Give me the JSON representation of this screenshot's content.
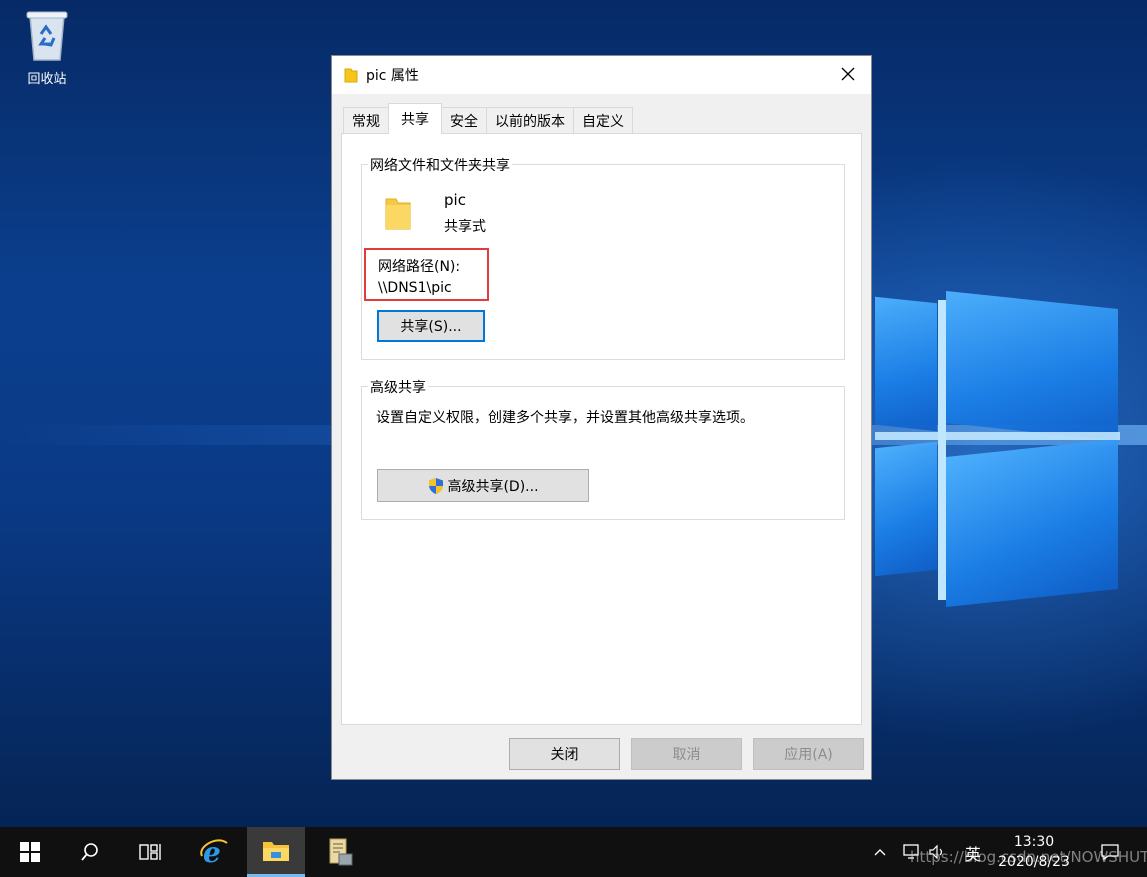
{
  "desktop": {
    "recycle_bin_label": "回收站"
  },
  "dialog": {
    "title": "pic 属性",
    "tabs": [
      {
        "label": "常规"
      },
      {
        "label": "共享"
      },
      {
        "label": "安全"
      },
      {
        "label": "以前的版本"
      },
      {
        "label": "自定义"
      }
    ],
    "active_tab": "共享",
    "network_sharing": {
      "legend": "网络文件和文件夹共享",
      "folder_name": "pic",
      "status": "共享式",
      "network_path_label": "网络路径(N):",
      "network_path_value": "\\\\DNS1\\pic",
      "share_button": "共享(S)..."
    },
    "advanced_sharing": {
      "legend": "高级共享",
      "description": "设置自定义权限，创建多个共享，并设置其他高级共享选项。",
      "button": "高级共享(D)..."
    },
    "footer": {
      "ok": "关闭",
      "cancel": "取消",
      "apply": "应用(A)"
    }
  },
  "taskbar": {
    "ime": "英",
    "time": "13:30",
    "date": "2020/8/23",
    "watermark": "https://blog.csdn.net/NOWSHUT"
  },
  "colors": {
    "accent": "#0078d7",
    "highlight_border": "#e23b3b",
    "taskbar": "#101010"
  }
}
